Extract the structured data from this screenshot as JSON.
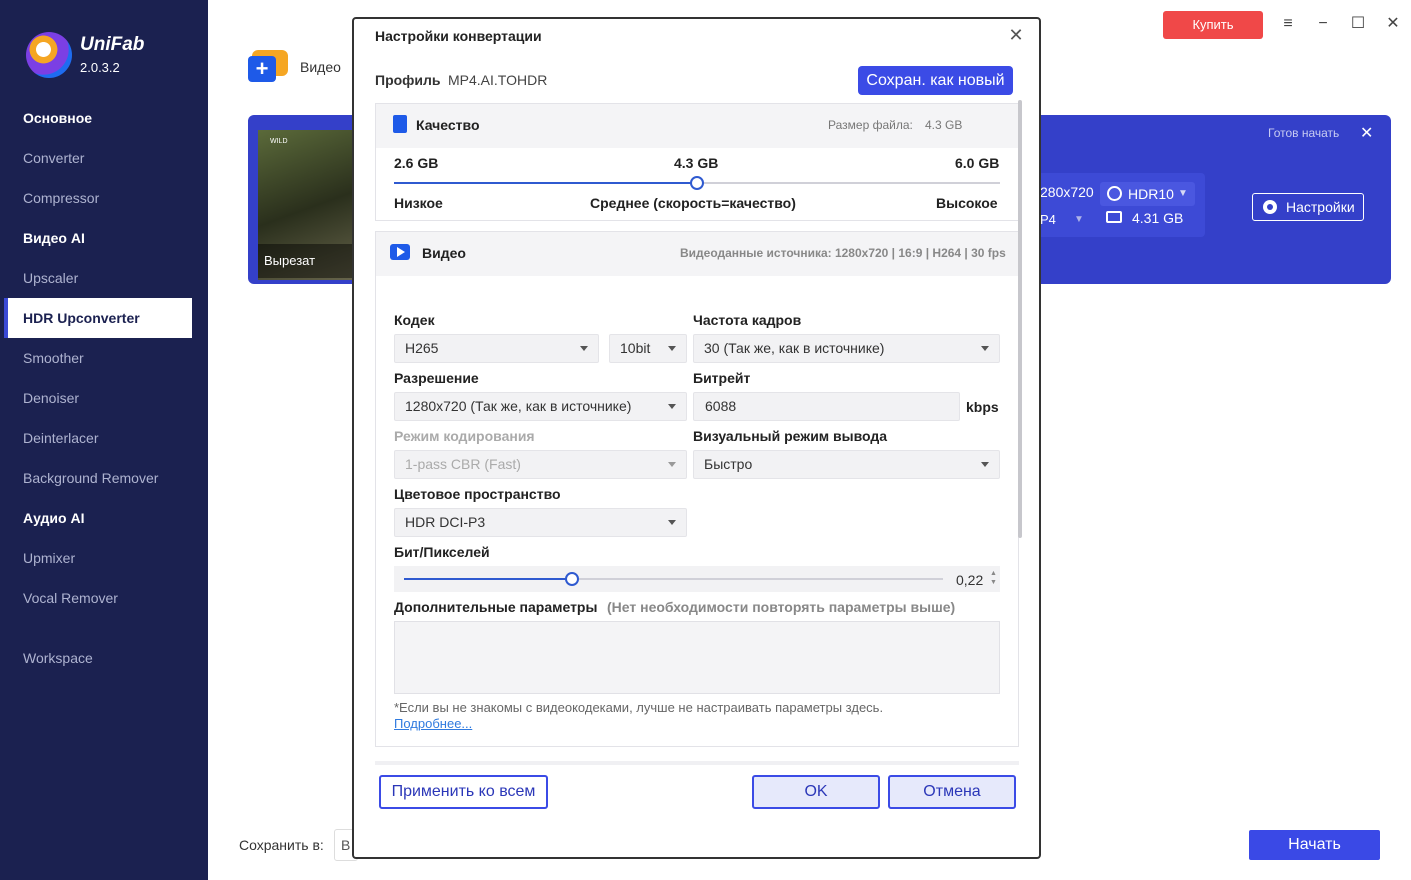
{
  "app": {
    "name": "UniFab",
    "version": "2.0.3.2"
  },
  "sidebar": {
    "items": [
      {
        "label": "Основное"
      },
      {
        "label": "Converter"
      },
      {
        "label": "Compressor"
      },
      {
        "label": "Видео AI"
      },
      {
        "label": "Upscaler"
      },
      {
        "label": "HDR Upconverter"
      },
      {
        "label": "Smoother"
      },
      {
        "label": "Denoiser"
      },
      {
        "label": "Deinterlacer"
      },
      {
        "label": "Background Remover"
      },
      {
        "label": "Аудио AI"
      },
      {
        "label": "Upmixer"
      },
      {
        "label": "Vocal Remover"
      },
      {
        "label": "Workspace"
      }
    ]
  },
  "topbar": {
    "buy_label": "Купить",
    "menu_icon": "≡",
    "minimize_icon": "−",
    "maximize_icon": "☐",
    "close_icon": "✕"
  },
  "main": {
    "add_video_label": "Видео",
    "task": {
      "thumb_logo": "WILD",
      "cut_label": "Вырезат",
      "ready_label": "Готов начать",
      "close_icon": "✕",
      "resolution": "280x720",
      "format": "P4",
      "hdr_label": "HDR10",
      "size": "4.31 GB",
      "settings_label": "Настройки"
    },
    "save_to_label": "Сохранить в:",
    "save_to_value": "В",
    "start_label": "Начать"
  },
  "dialog": {
    "title": "Настройки конвертации",
    "close_icon": "✕",
    "profile_label": "Профиль",
    "profile_value": "MP4.AI.TOHDR",
    "save_new_label": "Сохран. как новый",
    "quality": {
      "title": "Качество",
      "file_size_label": "Размер файла:",
      "file_size_value": "4.3 GB",
      "min_label": "2.6 GB",
      "mid_label": "4.3 GB",
      "max_label": "6.0 GB",
      "low_label": "Низкое",
      "mid_desc": "Среднее (скорость=качество)",
      "high_label": "Высокое",
      "slider_value": 0.5
    },
    "video": {
      "title": "Видео",
      "source_info": "Видеоданные источника: 1280x720 | 16:9 | H264 | 30 fps",
      "codec_label": "Кодек",
      "codec_value": "H265",
      "bitdepth_value": "10bit",
      "framerate_label": "Частота кадров",
      "framerate_value": "30 (Так же, как в источнике)",
      "resolution_label": "Разрешение",
      "resolution_value": "1280x720 (Так же, как в источнике)",
      "bitrate_label": "Битрейт",
      "bitrate_value": "6088",
      "bitrate_unit": "kbps",
      "encode_mode_label": "Режим кодирования",
      "encode_mode_value": "1-pass CBR (Fast)",
      "visual_mode_label": "Визуальный режим вывода",
      "visual_mode_value": "Быстро",
      "colorspace_label": "Цветовое пространство",
      "colorspace_value": "HDR DCI-P3",
      "bpp_label": "Бит/Пикселей",
      "bpp_value": "0,22",
      "bpp_spin_up": "▲",
      "bpp_spin_down": "▼",
      "extra_label": "Дополнительные параметры",
      "extra_note": "(Нет необходимости повторять параметры выше)",
      "hint": "*Если вы не знакомы с видеокодеками, лучше не настраивать параметры здесь.",
      "more_link": "Подробнее..."
    },
    "apply_all_label": "Применить ко всем",
    "ok_label": "OK",
    "cancel_label": "Отмена"
  },
  "colors": {
    "sidebar_bg": "#1b2150",
    "accent": "#3b4be6",
    "buy": "#f04848",
    "card": "#3440c9"
  }
}
